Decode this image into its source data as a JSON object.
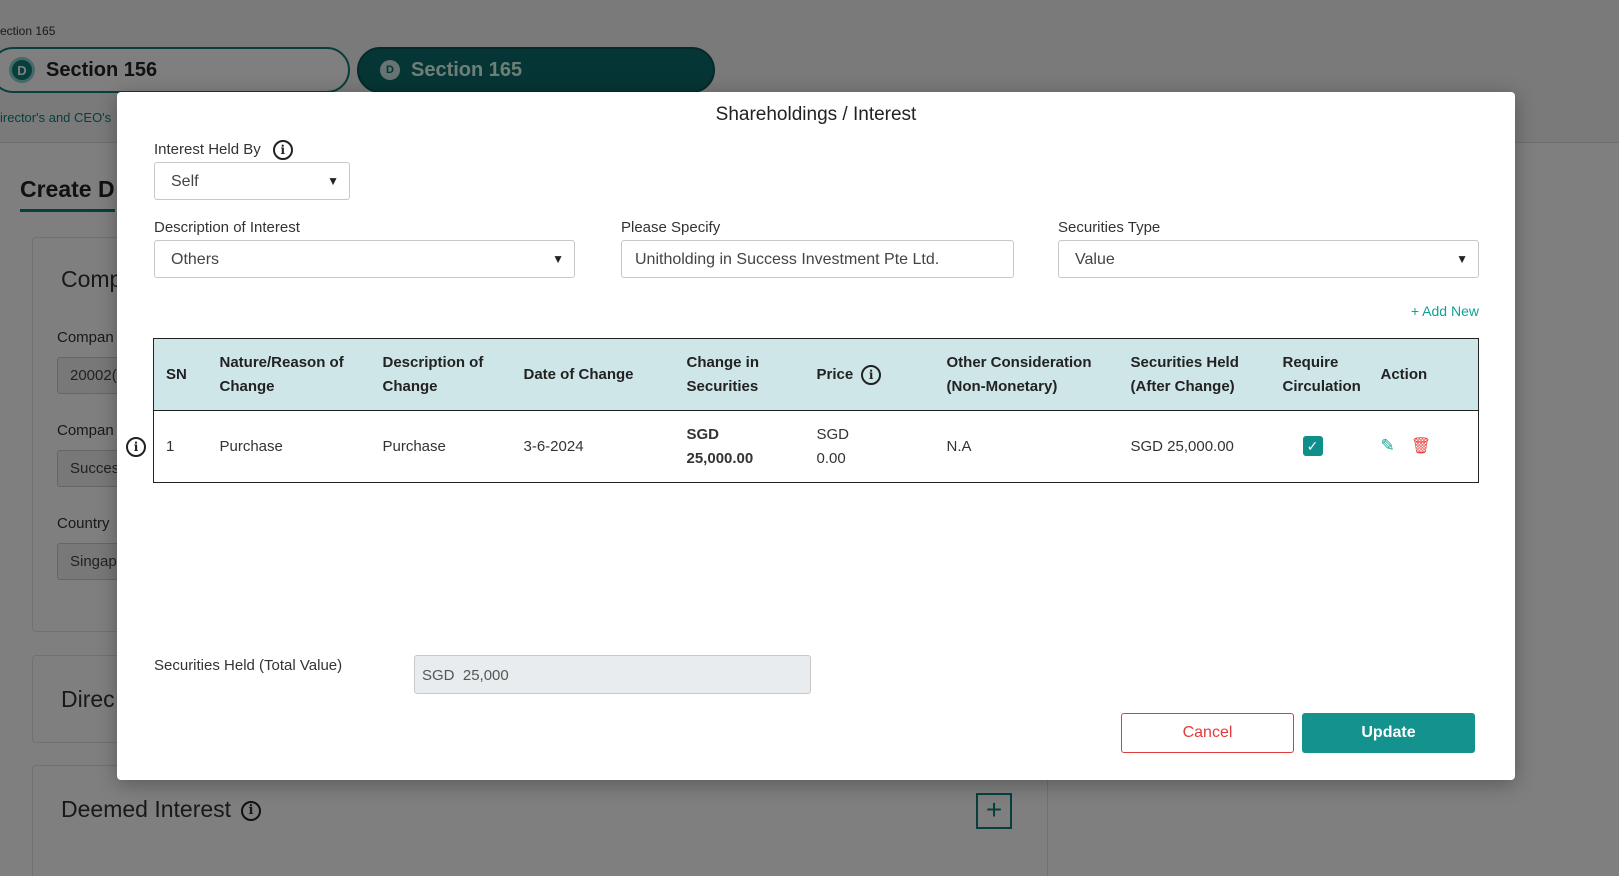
{
  "background": {
    "crumb": "ection 165",
    "pills": [
      {
        "badge": "D",
        "label": "Section 156"
      },
      {
        "badge": "D",
        "label": "Section 165"
      }
    ],
    "subtext": "irector's and CEO's",
    "create_heading": "Create D",
    "card1_heading": "Comp",
    "fields": [
      {
        "label": "Compan",
        "value": "20002("
      },
      {
        "label": "Compan",
        "value": "Succes"
      },
      {
        "label": "Country",
        "value": "Singap"
      }
    ],
    "card2_heading": "Direc",
    "card3_heading": "Deemed Interest",
    "info_icon": "i",
    "plus_icon": "+"
  },
  "modal": {
    "title": "Shareholdings / Interest",
    "info_icon": "i",
    "interest_held_by": {
      "label": "Interest Held By",
      "value": "Self"
    },
    "description_of_interest": {
      "label": "Description of Interest",
      "value": "Others"
    },
    "please_specify": {
      "label": "Please Specify",
      "value": "Unitholding in Success Investment Pte Ltd."
    },
    "securities_type": {
      "label": "Securities Type",
      "value": "Value"
    },
    "add_new": "+ Add New",
    "table": {
      "headers": {
        "sn": "SN",
        "nature": "Nature/Reason of Change",
        "description": "Description of Change",
        "date": "Date of Change",
        "change": "Change in Securities",
        "price": "Price",
        "other": "Other Consideration (Non-Monetary)",
        "held": "Securities Held (After Change)",
        "circulation": "Require Circulation",
        "action": "Action"
      },
      "rows": [
        {
          "sn": "1",
          "nature": "Purchase",
          "description": "Purchase",
          "date": "3-6-2024",
          "change_currency": "SGD",
          "change_amount": "25,000.00",
          "price_currency": "SGD",
          "price_amount": "0.00",
          "other": "N.A",
          "held": "SGD 25,000.00",
          "require_circulation": true
        }
      ]
    },
    "total": {
      "label": "Securities Held (Total Value)",
      "currency": "SGD",
      "value": "25,000"
    },
    "cancel_label": "Cancel",
    "update_label": "Update"
  },
  "icons": {
    "chevron": "chevron-down-icon",
    "check": "check-icon",
    "edit": "pencil-icon",
    "delete": "trash-icon"
  },
  "colors": {
    "accent": "#14928e",
    "cancel": "#e23b3b",
    "highlight": "#12b08a",
    "table_header": "#cfe6e9"
  }
}
